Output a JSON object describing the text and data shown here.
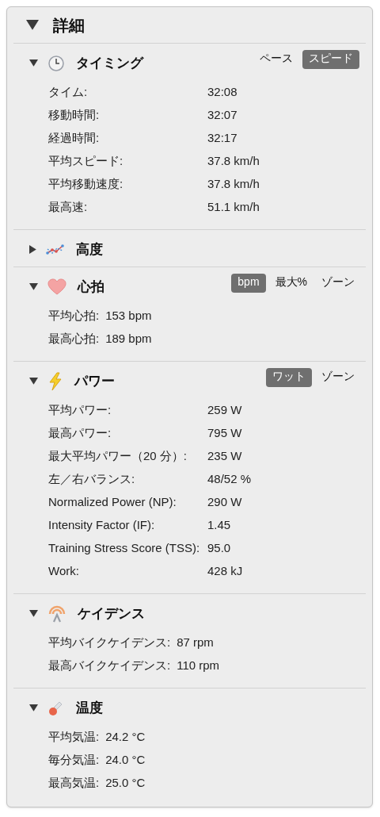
{
  "panel": {
    "title": "詳細",
    "expanded": true
  },
  "sections": [
    {
      "title": "タイミング",
      "kind": "timing",
      "expanded": true,
      "toggles": [
        {
          "label": "ペース",
          "selected": false
        },
        {
          "label": "スピード",
          "selected": true
        }
      ],
      "rows": [
        {
          "label": "タイム:",
          "value": "32:08"
        },
        {
          "label": "移動時間:",
          "value": "32:07"
        },
        {
          "label": "経過時間:",
          "value": "32:17"
        },
        {
          "label": "平均スピード:",
          "value": "37.8 km/h"
        },
        {
          "label": "平均移動速度:",
          "value": "37.8 km/h"
        },
        {
          "label": "最高速:",
          "value": "51.1 km/h"
        }
      ]
    },
    {
      "title": "高度",
      "kind": "altitude",
      "expanded": false
    },
    {
      "title": "心拍",
      "kind": "heartrate",
      "expanded": true,
      "toggles": [
        {
          "label": "bpm",
          "selected": true
        },
        {
          "label": "最大%",
          "selected": false
        },
        {
          "label": "ゾーン",
          "selected": false
        }
      ],
      "rows": [
        {
          "label": "平均心拍:",
          "value": "153 bpm"
        },
        {
          "label": "最高心拍:",
          "value": "189 bpm"
        }
      ]
    },
    {
      "title": "パワー",
      "kind": "power",
      "expanded": true,
      "toggles": [
        {
          "label": "ワット",
          "selected": true
        },
        {
          "label": "ゾーン",
          "selected": false
        }
      ],
      "rows": [
        {
          "label": "平均パワー:",
          "value": "259 W"
        },
        {
          "label": "最高パワー:",
          "value": "795 W"
        },
        {
          "label": "最大平均パワー（20 分）:",
          "value": "235 W"
        },
        {
          "label": "左／右バランス:",
          "value": "48/52 %"
        },
        {
          "label": "Normalized Power (NP):",
          "value": "290 W"
        },
        {
          "label": "Intensity Factor (IF):",
          "value": "1.45"
        },
        {
          "label": "Training Stress Score (TSS):",
          "value": "95.0"
        },
        {
          "label": "Work:",
          "value": "428 kJ"
        }
      ]
    },
    {
      "title": "ケイデンス",
      "kind": "cadence",
      "expanded": true,
      "rows": [
        {
          "label": "平均バイクケイデンス:",
          "value": "87 rpm"
        },
        {
          "label": "最高バイクケイデンス:",
          "value": "110 rpm"
        }
      ]
    },
    {
      "title": "温度",
      "kind": "temperature",
      "expanded": true,
      "rows": [
        {
          "label": "平均気温:",
          "value": "24.2 °C"
        },
        {
          "label": "毎分気温:",
          "value": "24.0 °C"
        },
        {
          "label": "最高気温:",
          "value": "25.0 °C"
        }
      ]
    }
  ]
}
